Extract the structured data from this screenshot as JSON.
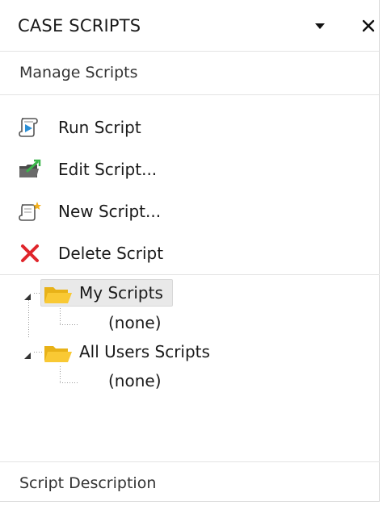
{
  "panel": {
    "title": "CASE SCRIPTS",
    "dropdown_icon": "triangle-down-icon",
    "close_icon": "close-icon"
  },
  "section": {
    "manage_label": "Manage Scripts",
    "description_label": "Script Description"
  },
  "actions": [
    {
      "label": "Run Script",
      "icon": "run-script-icon"
    },
    {
      "label": "Edit Script...",
      "icon": "edit-script-icon"
    },
    {
      "label": "New Script...",
      "icon": "new-script-icon"
    },
    {
      "label": "Delete Script",
      "icon": "delete-icon"
    }
  ],
  "tree": [
    {
      "label": "My Scripts",
      "expanded": true,
      "selected": true,
      "children": [
        {
          "label": "(none)"
        }
      ]
    },
    {
      "label": "All Users Scripts",
      "expanded": true,
      "selected": false,
      "children": [
        {
          "label": "(none)"
        }
      ]
    }
  ],
  "colors": {
    "folder": "#f5c518",
    "delete": "#e0252b",
    "run_accent": "#2b8fd6",
    "edit_accent": "#3bb54a",
    "new_star": "#f2b01e"
  }
}
